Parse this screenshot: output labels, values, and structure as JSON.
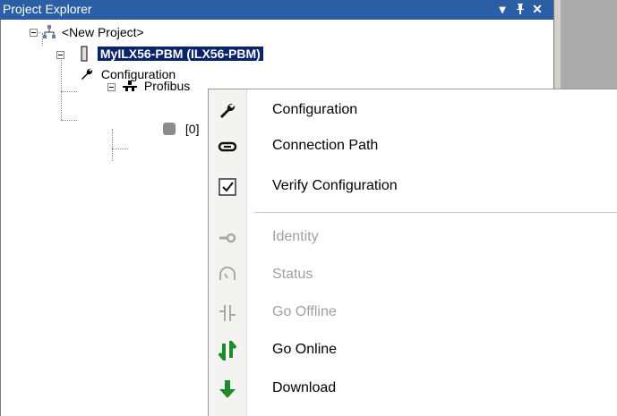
{
  "panel": {
    "title": "Project Explorer",
    "dropdown_icon": "▾",
    "pin_icon": "ᛠ",
    "close_icon": "✕"
  },
  "tree": {
    "root": {
      "label": "<New Project>"
    },
    "module": {
      "label": "MyILX56-PBM (ILX56-PBM)"
    },
    "config": {
      "label": "Configuration"
    },
    "profibus": {
      "label": "Profibus"
    },
    "slave": {
      "label": "[0]"
    }
  },
  "menu": {
    "items": [
      {
        "label": "Configuration",
        "icon": "wrench-icon",
        "enabled": true
      },
      {
        "label": "Connection Path",
        "icon": "chain-link-icon",
        "enabled": true
      },
      {
        "label": "Verify Configuration",
        "icon": "checkbox-icon",
        "enabled": true
      },
      {
        "label": "Identity",
        "icon": "key-icon",
        "enabled": false
      },
      {
        "label": "Status",
        "icon": "gauge-icon",
        "enabled": false
      },
      {
        "label": "Go Offline",
        "icon": "go-offline-icon",
        "enabled": false
      },
      {
        "label": "Go Online",
        "icon": "go-online-icon",
        "enabled": true
      },
      {
        "label": "Download",
        "icon": "download-arrow-icon",
        "enabled": true
      }
    ]
  },
  "colors": {
    "title_bar": "#2b5ea3",
    "selection": "#0a246a",
    "online_green": "#1e8a2e",
    "disabled_text": "#a0a0a0"
  }
}
